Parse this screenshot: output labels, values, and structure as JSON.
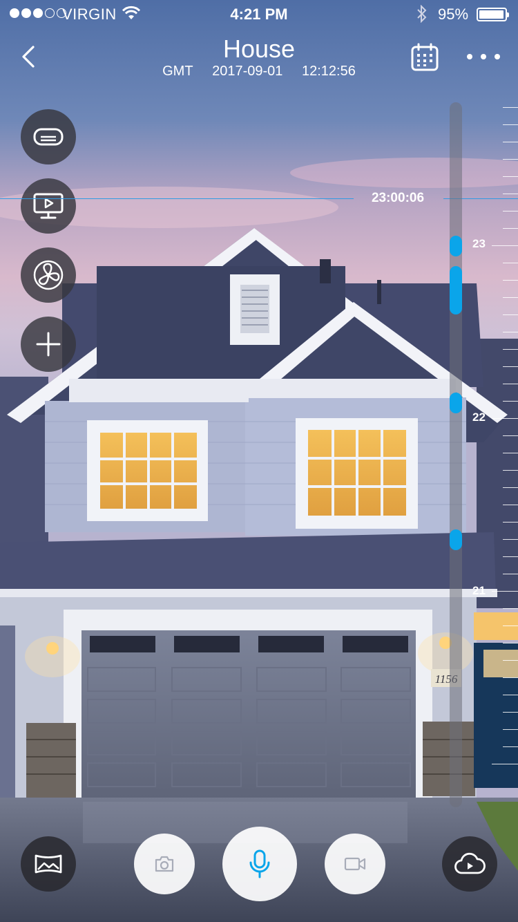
{
  "status_bar": {
    "signal_dots_filled": 3,
    "signal_dots_total": 5,
    "carrier": "VIRGIN",
    "time": "4:21 PM",
    "battery_percent": "95%",
    "icons": [
      "wifi-icon",
      "bluetooth-icon",
      "battery-icon"
    ]
  },
  "header": {
    "title": "House",
    "timezone": "GMT",
    "date": "2017-09-01",
    "time": "12:12:56",
    "icons": [
      "back-chevron-icon",
      "calendar-icon",
      "more-icon"
    ]
  },
  "side_controls": [
    {
      "icon": "air-conditioner-icon"
    },
    {
      "icon": "tv-icon"
    },
    {
      "icon": "fan-icon"
    },
    {
      "icon": "plus-icon"
    }
  ],
  "timeline": {
    "current_time": "23:00:06",
    "hour_labels": [
      "23",
      "22",
      "21"
    ],
    "accent_color": "#0aa5ea"
  },
  "bottom_bar": {
    "buttons": [
      "panorama-icon",
      "camera-icon",
      "microphone-icon",
      "video-camera-icon",
      "cloud-play-icon"
    ]
  },
  "scene": {
    "house_number": "1156"
  },
  "colors": {
    "accent": "#0aa5ea",
    "control_dark": "#37373e"
  }
}
